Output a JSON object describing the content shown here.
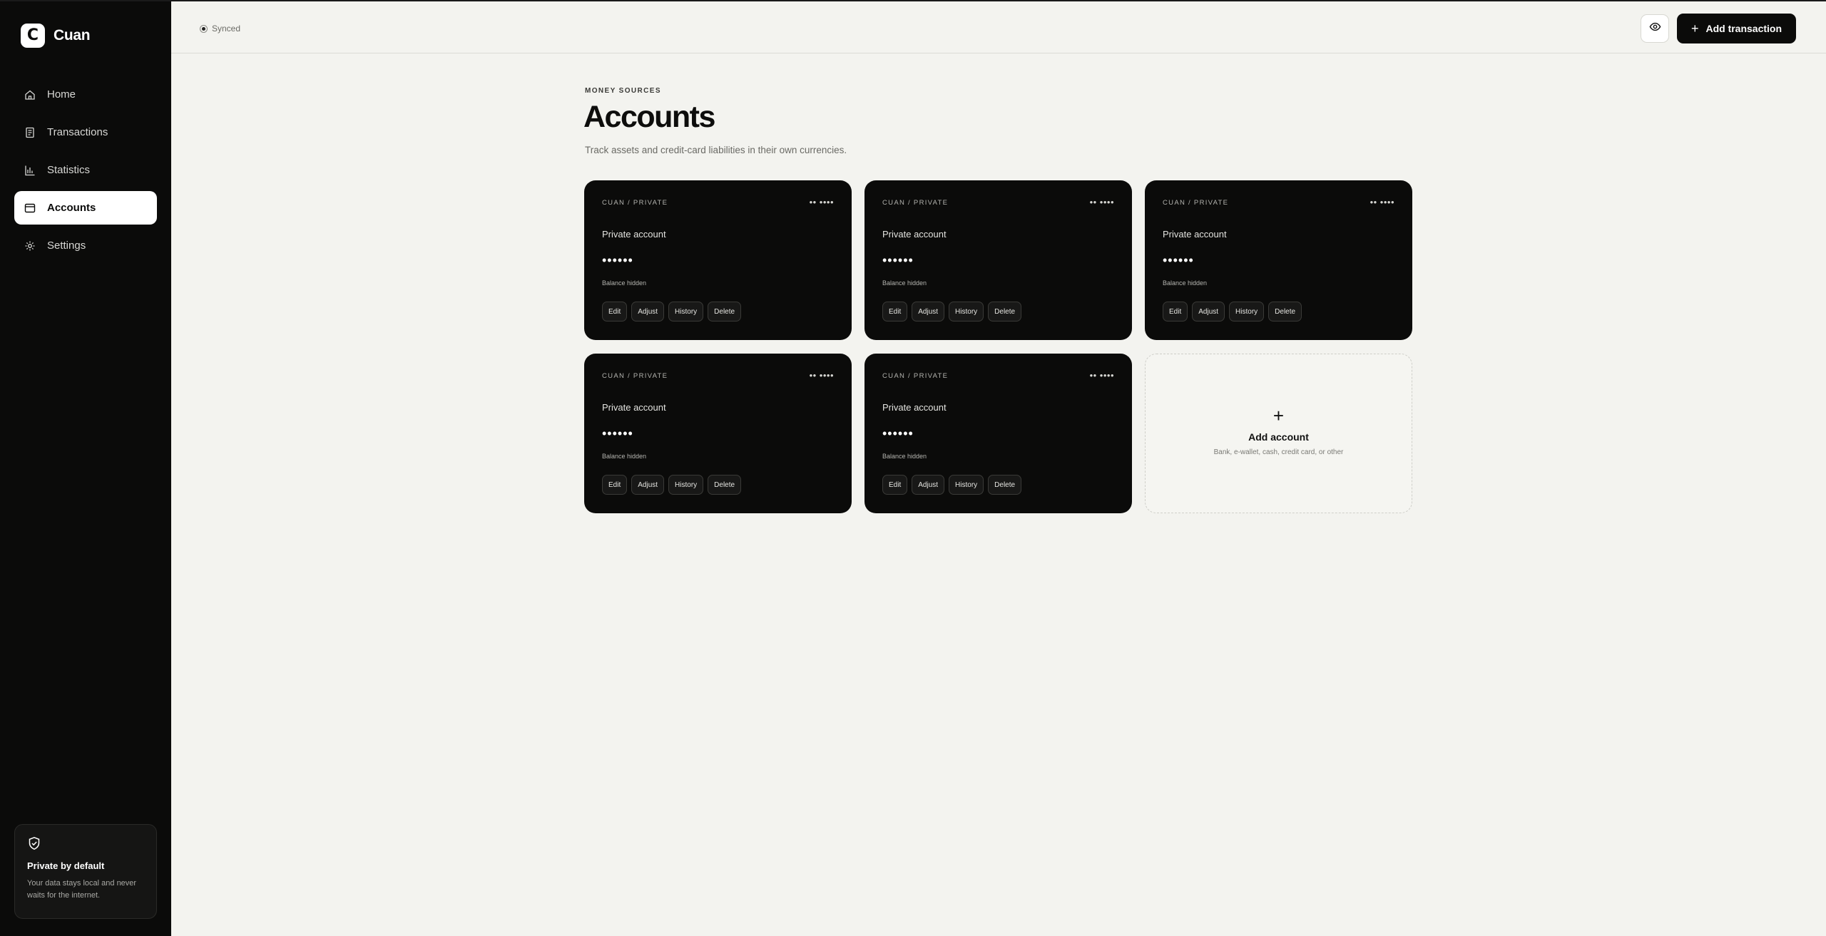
{
  "app": {
    "logo_letter": "C",
    "name": "Cuan"
  },
  "sidebar": {
    "items": [
      {
        "label": "Home",
        "icon": "home-icon",
        "active": false
      },
      {
        "label": "Transactions",
        "icon": "receipt-icon",
        "active": false
      },
      {
        "label": "Statistics",
        "icon": "bar-chart-icon",
        "active": false
      },
      {
        "label": "Accounts",
        "icon": "wallet-icon",
        "active": true
      },
      {
        "label": "Settings",
        "icon": "gear-icon",
        "active": false
      }
    ],
    "privacy": {
      "title": "Private by default",
      "text": "Your data stays local and never waits for the internet."
    }
  },
  "header": {
    "status": "Synced",
    "add_transaction_label": "Add transaction"
  },
  "main": {
    "eyebrow": "MONEY SOURCES",
    "title": "Accounts",
    "subtitle": "Track assets and credit-card liabilities in their own currencies."
  },
  "accounts": [
    {
      "tag": "CUAN / PRIVATE",
      "masked_number": "•• ••••",
      "name": "Private account",
      "balance": "••••••",
      "balance_note": "Balance hidden"
    },
    {
      "tag": "CUAN / PRIVATE",
      "masked_number": "•• ••••",
      "name": "Private account",
      "balance": "••••••",
      "balance_note": "Balance hidden"
    },
    {
      "tag": "CUAN / PRIVATE",
      "masked_number": "•• ••••",
      "name": "Private account",
      "balance": "••••••",
      "balance_note": "Balance hidden"
    },
    {
      "tag": "CUAN / PRIVATE",
      "masked_number": "•• ••••",
      "name": "Private account",
      "balance": "••••••",
      "balance_note": "Balance hidden"
    },
    {
      "tag": "CUAN / PRIVATE",
      "masked_number": "•• ••••",
      "name": "Private account",
      "balance": "••••••",
      "balance_note": "Balance hidden"
    }
  ],
  "account_actions": {
    "edit": "Edit",
    "adjust": "Adjust",
    "history": "History",
    "delete": "Delete"
  },
  "add_account": {
    "plus": "+",
    "title": "Add account",
    "subtitle": "Bank, e-wallet, cash, credit card, or other"
  }
}
